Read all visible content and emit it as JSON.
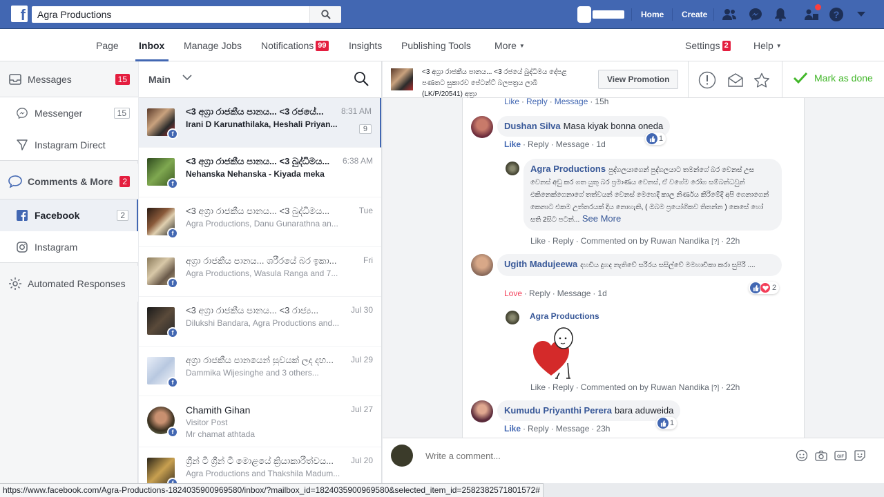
{
  "topbar": {
    "search_value": "Agra Productions",
    "home": "Home",
    "create": "Create"
  },
  "page_nav": {
    "page": "Page",
    "inbox": "Inbox",
    "manage_jobs": "Manage Jobs",
    "notifications": "Notifications",
    "notifications_count": "99",
    "insights": "Insights",
    "publishing_tools": "Publishing Tools",
    "more": "More",
    "settings": "Settings",
    "settings_count": "2",
    "help": "Help"
  },
  "sidebar": {
    "messages": "Messages",
    "messages_count": "15",
    "messenger": "Messenger",
    "messenger_count": "15",
    "instagram_direct": "Instagram Direct",
    "comments_more": "Comments & More",
    "comments_count": "2",
    "facebook": "Facebook",
    "facebook_count": "2",
    "instagram": "Instagram",
    "automated": "Automated Responses"
  },
  "thread_list": {
    "filter": "Main",
    "threads": [
      {
        "title": "<3 අග්‍රා රාජකීය පානය... <3 රජයේ...",
        "sub": "Irani D Karunathilaka, Heshali Priyan...",
        "date": "8:31 AM",
        "count": "9"
      },
      {
        "title": "<3 අග්‍රා රාජකීය පානය... <3 බුද්ධිමය...",
        "sub": "Nehanska Nehanska - Kiyada meka",
        "date": "6:38 AM"
      },
      {
        "title": "<3 අග්‍රා රාජකීය පානය... <3 බුද්ධිමය...",
        "sub": "Agra Productions, Danu Gunarathna an...",
        "date": "Tue"
      },
      {
        "title": "අග්‍රා රාජකීය පානය... ශරීරයේ බර ඉකා...",
        "sub": "Agra Productions, Wasula Ranga and 7...",
        "date": "Fri"
      },
      {
        "title": "<3 අග්‍රා රාජකීය පානය... <3 රාජ්‍ය...",
        "sub": "Dilukshi Bandara, Agra Productions and...",
        "date": "Jul 30"
      },
      {
        "title": "අග්‍රා රාජකීය පානයෙන් සුවයක් ලද දහ...",
        "sub": "Dammika Wijesinghe and 3 others...",
        "date": "Jul 29"
      },
      {
        "title": "Chamith Gihan",
        "sub": "Visitor Post",
        "sub2": "Mr chamat athtada",
        "date": "Jul 27"
      },
      {
        "title": "ග්‍රීන් ටී ග්‍රීන් ටී මොළයේ ක්‍රියාකාරීත්වය...",
        "sub": "Agra Productions and Thakshila Madum...",
        "date": "Jul 20"
      }
    ]
  },
  "detail": {
    "header_title": "<3 අග්‍රා රාජකීය පානය... <3 රජයේ බුද්ධිමය දේපළ පණතට සුකාරව පේටන්ට් බලපත්‍රය ලාබී (LK/P/20541) අත්‍රා",
    "view_promotion": "View Promotion",
    "mark_done": "Mark as done"
  },
  "comments": {
    "top_actions": {
      "like": "Like",
      "reply": "Reply",
      "message": "Message",
      "time": "15h"
    },
    "c1": {
      "name": "Dushan Silva",
      "text": "Masa kiyak bonna oneda",
      "like": "Like",
      "reply": "Reply",
      "message": "Message",
      "time": "1d",
      "reactions": "1"
    },
    "r1": {
      "name": "Agra Productions",
      "text": "පුද්ගලයාගෙන් පුද්ගලයාට තමන්ගේ බර වෙනස් උස වෙනස් අඩු කර ගත යුතු බර ප්‍රමාණය වෙනස්, ඒ වගේම රෝග සම්බන්ධවුන් එකිනෙක්ගෙනාගේ තත්වයන් වෙනස් මෙහෙදී කාල නිර්ණය කිරිමේදී අපි ගෙනාගෙන් කෙනාට එකම උත්තරයක් දිය නොහැකි, ( ඔබම ප්‍රයෝගිකව තිතන්න ) කෙසේ හෝ සති 2සිට පටන්...",
      "see_more": "See More",
      "like": "Like",
      "reply": "Reply",
      "commented_on": "Commented on by Ruwan Nandika",
      "q": "[?]",
      "time": "22h"
    },
    "c2": {
      "name": "Ugith Madujeewa",
      "text": "දහඩිය දුගද නැතිවේ සරිරය සසිල්වේ මමහාචිකා කරා සුපිරි ....",
      "love": "Love",
      "reply": "Reply",
      "message": "Message",
      "time": "1d",
      "reactions": "2"
    },
    "r2": {
      "name": "Agra Productions",
      "like": "Like",
      "reply": "Reply",
      "commented_on": "Commented on by Ruwan Nandika",
      "q": "[?]",
      "time": "22h"
    },
    "c3": {
      "name": "Kumudu Priyanthi Perera",
      "text": "bara aduweida",
      "like": "Like",
      "reply": "Reply",
      "message": "Message",
      "time": "23h",
      "reactions": "1"
    }
  },
  "composer": {
    "placeholder": "Write a comment..."
  },
  "statusbar": {
    "url": "https://www.facebook.com/Agra-Productions-1824035900969580/inbox/?mailbox_id=1824035900969580&selected_item_id=2582382571801572#"
  }
}
